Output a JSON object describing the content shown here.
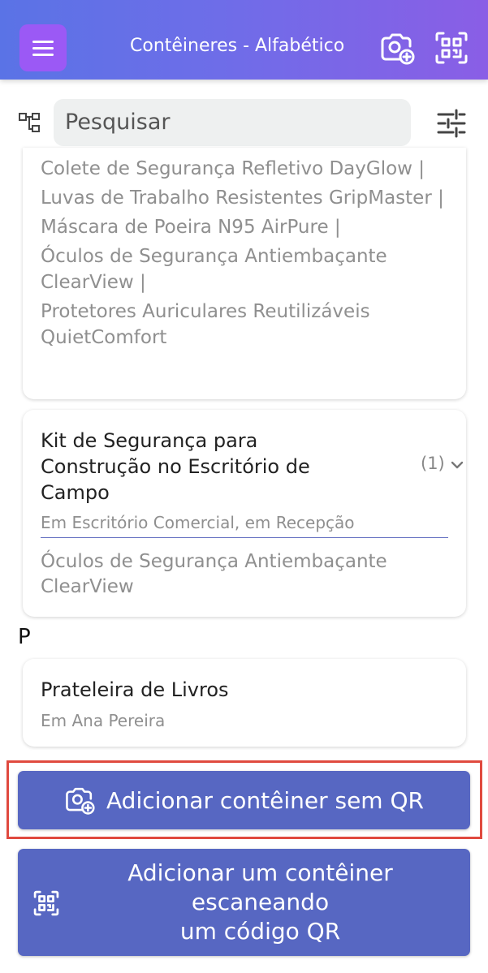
{
  "header": {
    "title": "Contêineres - Alfabético"
  },
  "search": {
    "placeholder": "Pesquisar"
  },
  "card1": {
    "items": [
      "Colete de Segurança Refletivo DayGlow |",
      "Luvas de Trabalho Resistentes GripMaster |",
      "Máscara de Poeira N95 AirPure |",
      "Óculos de Segurança Antiembaçante ClearView |",
      "Protetores Auriculares Reutilizáveis QuietComfort"
    ]
  },
  "card2": {
    "title": "Kit de Segurança para Construção no Escritório de Campo",
    "count": "(1)",
    "location": "Em Escritório Comercial, em Recepção",
    "item": "Óculos de Segurança Antiembaçante ClearView"
  },
  "section": {
    "letter": "P"
  },
  "card3": {
    "title": "Prateleira de Livros",
    "location": "Em Ana Pereira"
  },
  "buttons": {
    "add_no_qr": "Adicionar contêiner sem QR",
    "add_scan_line1": "Adicionar um contêiner",
    "add_scan_line2": "escaneando",
    "add_scan_line3": "um código QR"
  },
  "colors": {
    "header_start": "#5a73e6",
    "header_end": "#8a5ee6",
    "menu_button": "#9b59f5",
    "button_bg": "#5767c2",
    "highlight": "#e04a3f"
  }
}
